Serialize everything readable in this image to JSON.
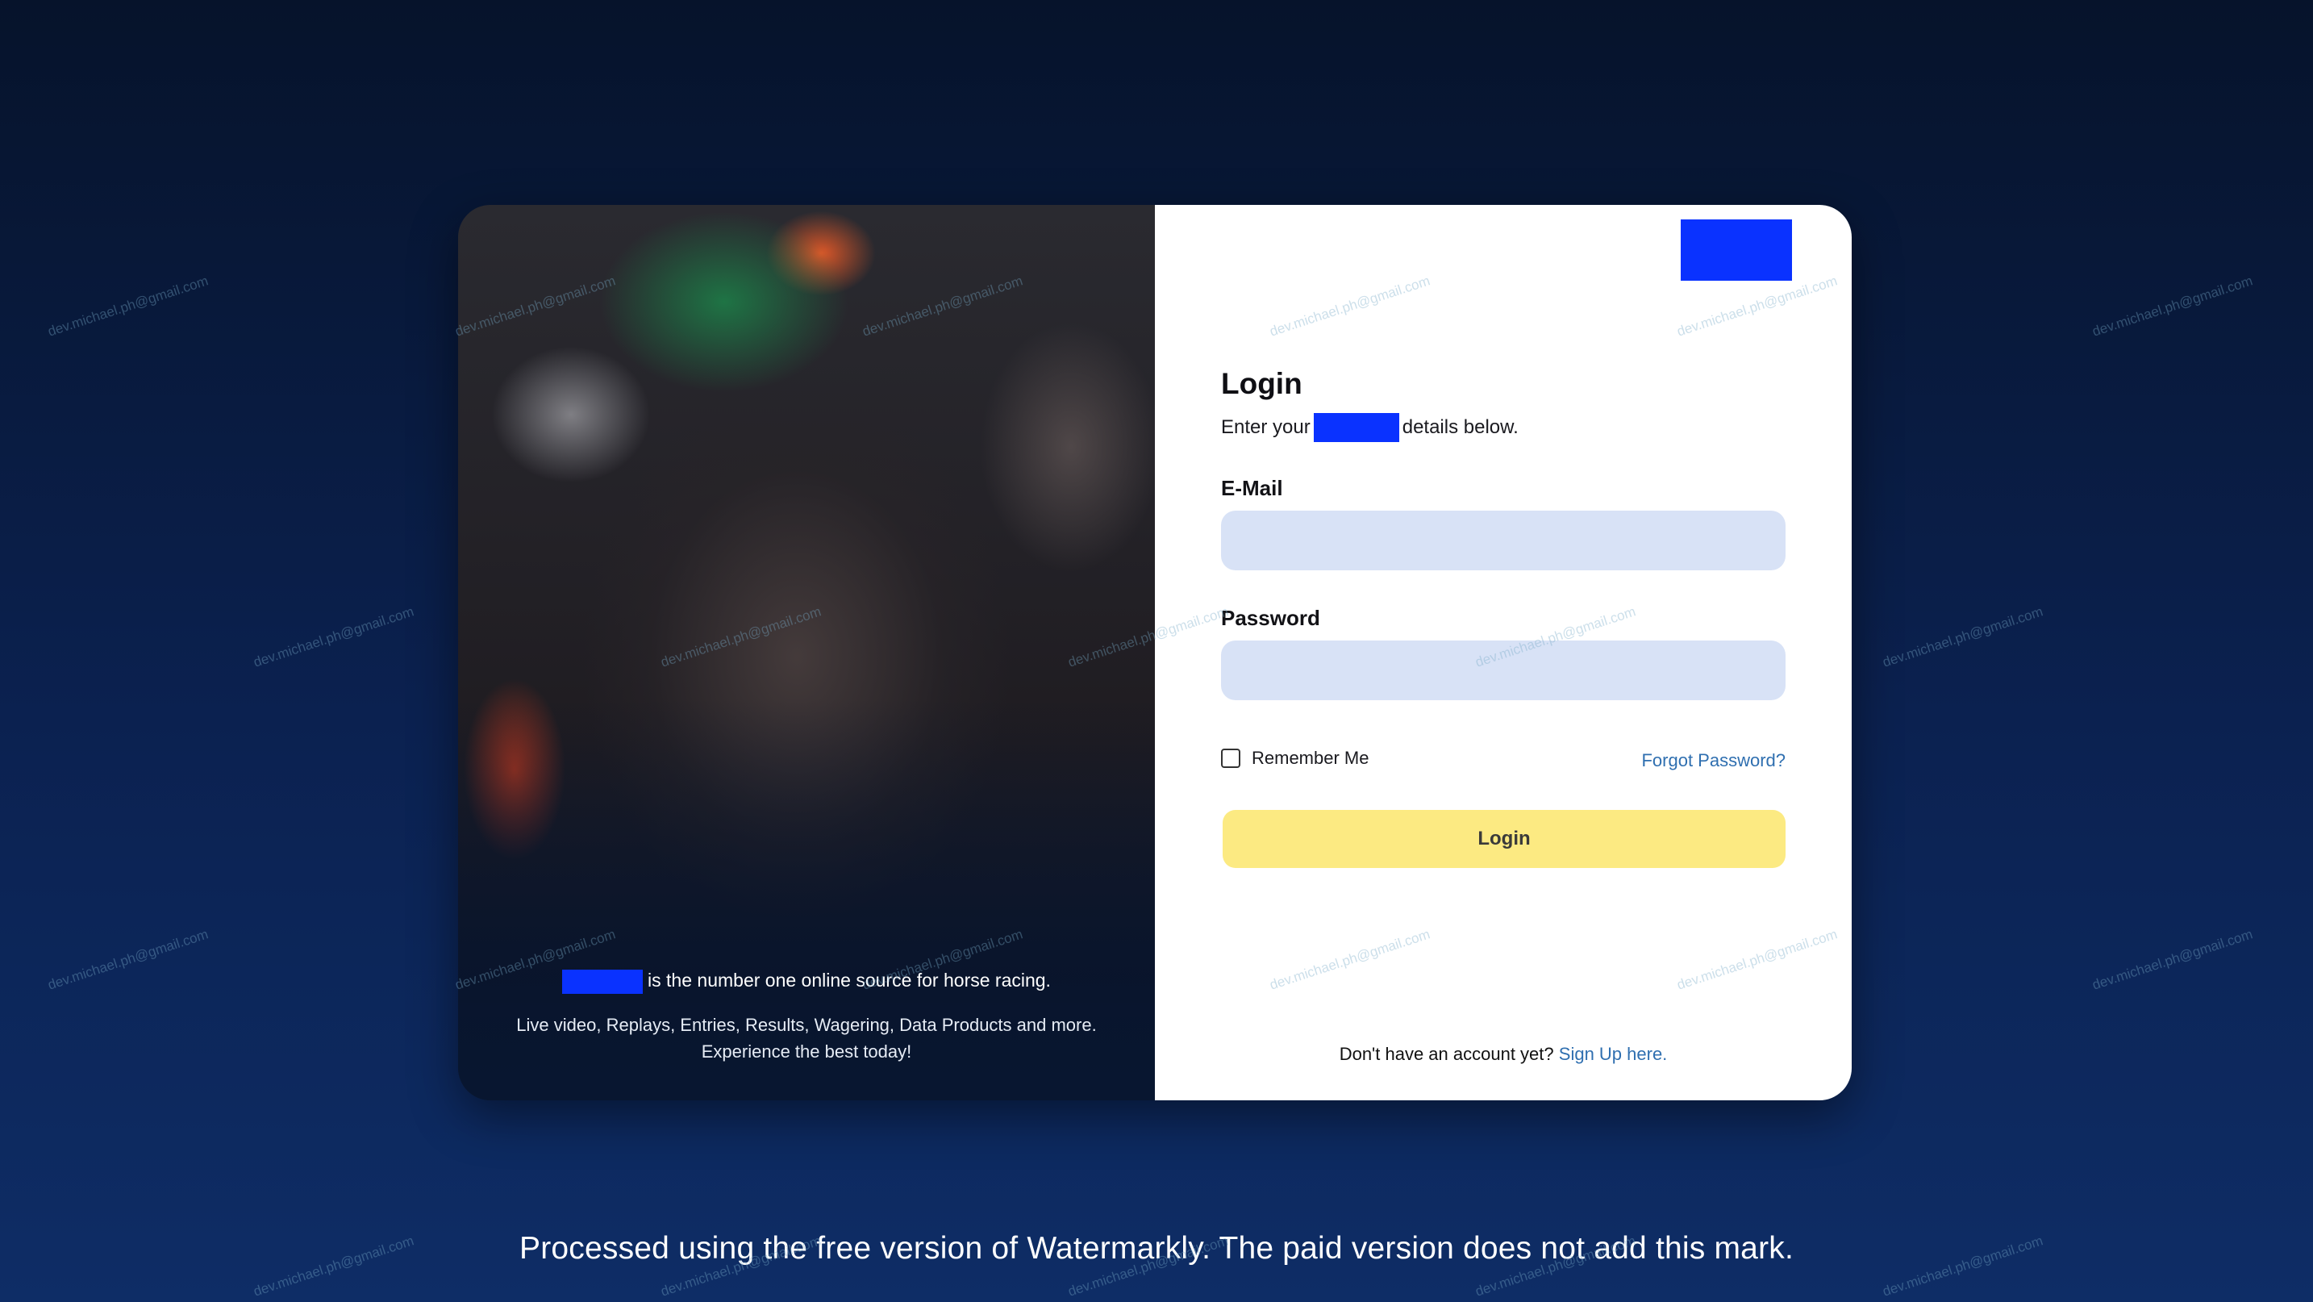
{
  "hero": {
    "tagline": "is the number one online source for horse racing.",
    "description_line1": "Live video, Replays, Entries, Results, Wagering, Data Products and more.",
    "description_line2": "Experience the best today!"
  },
  "login": {
    "title": "Login",
    "subtitle_before": "Enter your",
    "subtitle_after": "details below.",
    "email_label": "E-Mail",
    "email_value": "",
    "password_label": "Password",
    "password_value": "",
    "remember_label": "Remember Me",
    "remember_checked": false,
    "forgot_label": "Forgot Password?",
    "submit_label": "Login",
    "signup_prompt": "Don't have an account yet?",
    "signup_link": "Sign Up here."
  },
  "colors": {
    "redaction": "#0a32ff",
    "input_bg": "#d8e2f6",
    "button_bg": "#fcea82",
    "link": "#2f6fb0"
  },
  "watermark": {
    "notice": "Processed using the free version of Watermarkly. The paid version does not add this mark.",
    "email": "dev.michael.ph@gmail.com"
  }
}
